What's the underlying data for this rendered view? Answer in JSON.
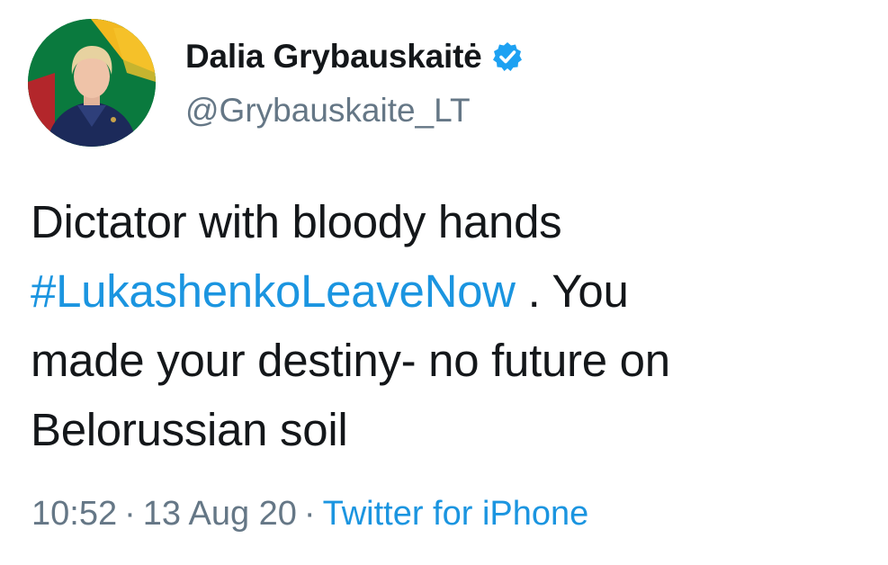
{
  "author": {
    "display_name": "Dalia Grybauskaitė",
    "handle": "@Grybauskaite_LT",
    "verified_icon": "verified-badge-icon",
    "avatar_icon": "profile-photo"
  },
  "tweet": {
    "text_line1": "Dictator with bloody hands",
    "hashtag": "#LukashenkoLeaveNow",
    "text_after_hashtag": " . You",
    "text_line3": "made your destiny- no future on",
    "text_line4": "Belorussian soil"
  },
  "meta": {
    "time": "10:52",
    "separator": "·",
    "date": "13 Aug 20",
    "source": "Twitter for iPhone"
  },
  "colors": {
    "link": "#1b95e0",
    "secondary_text": "#657786",
    "primary_text": "#14171a",
    "verified": "#1da1f2"
  }
}
